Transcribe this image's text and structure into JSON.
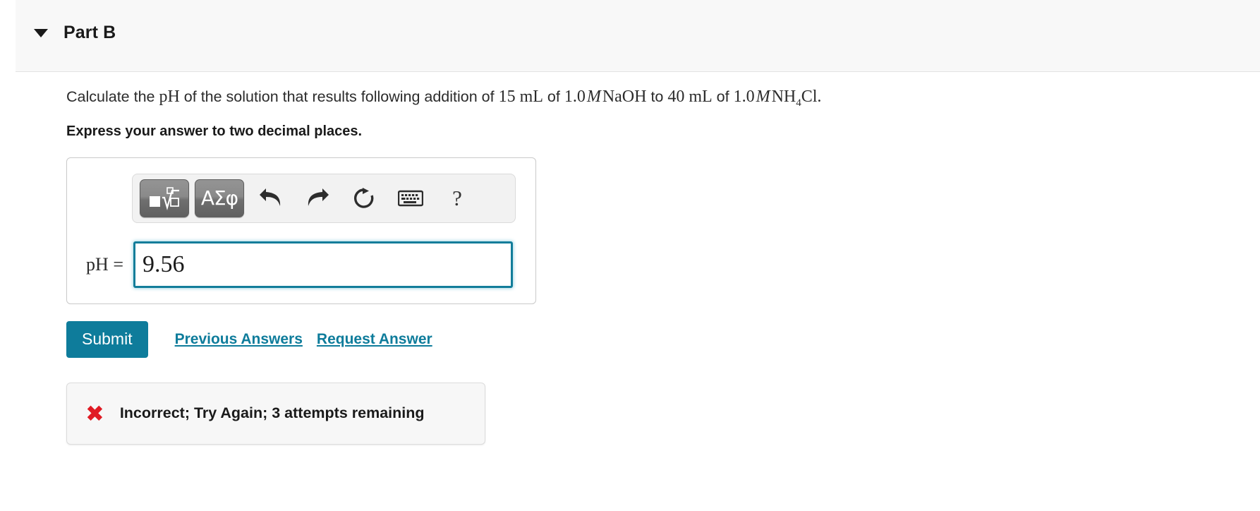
{
  "part": {
    "title": "Part B",
    "caret_icon": "caret-down-icon",
    "expanded": true
  },
  "question": {
    "segments": [
      {
        "text": "Calculate the ",
        "style": "normal"
      },
      {
        "text": "pH",
        "style": "math"
      },
      {
        "text": " of the solution that results following addition of ",
        "style": "normal"
      },
      {
        "text": "15 mL",
        "style": "math"
      },
      {
        "text": " of ",
        "style": "normal"
      },
      {
        "text": "1.0",
        "style": "math"
      },
      {
        "text": "M",
        "style": "mathvar"
      },
      {
        "text": "NaOH",
        "style": "math"
      },
      {
        "text": " to ",
        "style": "normal"
      },
      {
        "text": "40 mL",
        "style": "math"
      },
      {
        "text": " of ",
        "style": "normal"
      },
      {
        "text": "1.0",
        "style": "math"
      },
      {
        "text": "M",
        "style": "mathvar"
      },
      {
        "text": "NH4Cl.",
        "style": "math"
      }
    ],
    "full_text": "Calculate the pH of the solution that results following addition of 15 mL of 1.0 M NaOH to 40 mL of 1.0 M NH4Cl.",
    "lead": "Calculate the ",
    "ph": "pH",
    "mid1": " of the solution that results following addition of ",
    "vol1": "15 mL",
    "of1": " of ",
    "conc1": "1.0",
    "molar1": "M",
    "base": "NaOH",
    "to": " to ",
    "vol2": "40 mL",
    "of2": " of ",
    "conc2": "1.0",
    "molar2": "M",
    "salt_main": "NH",
    "salt_sub": "4",
    "salt_end": "Cl.",
    "instruction": "Express your answer to two decimal places."
  },
  "answer": {
    "label": "pH =",
    "value": "9.56",
    "placeholder": "",
    "focused": true,
    "focus_color": "#127d9a"
  },
  "toolbar": {
    "buttons": [
      {
        "name": "template-sqrt-button",
        "icon": "sqrt-template-icon",
        "label": ""
      },
      {
        "name": "greek-symbols-button",
        "icon": "greek-symbols-icon",
        "label": "ΑΣφ"
      },
      {
        "name": "undo-button",
        "icon": "undo-arrow-icon",
        "label": ""
      },
      {
        "name": "redo-button",
        "icon": "redo-arrow-icon",
        "label": ""
      },
      {
        "name": "reset-button",
        "icon": "reset-circular-arrow-icon",
        "label": ""
      },
      {
        "name": "keyboard-button",
        "icon": "keyboard-icon",
        "label": ""
      },
      {
        "name": "help-button",
        "icon": "question-mark-icon",
        "label": "?"
      }
    ],
    "greek_label": "ΑΣφ",
    "help_label": "?"
  },
  "actions": {
    "submit_label": "Submit",
    "previous_answers_label": "Previous Answers",
    "request_answer_label": "Request Answer",
    "submit_color": "#0e7c9b",
    "link_color": "#0e7c9b"
  },
  "feedback": {
    "icon": "x-mark-icon",
    "icon_glyph": "✖",
    "icon_color": "#e01b24",
    "message": "Incorrect; Try Again; 3 attempts remaining",
    "status": "incorrect",
    "attempts_remaining": 3
  }
}
